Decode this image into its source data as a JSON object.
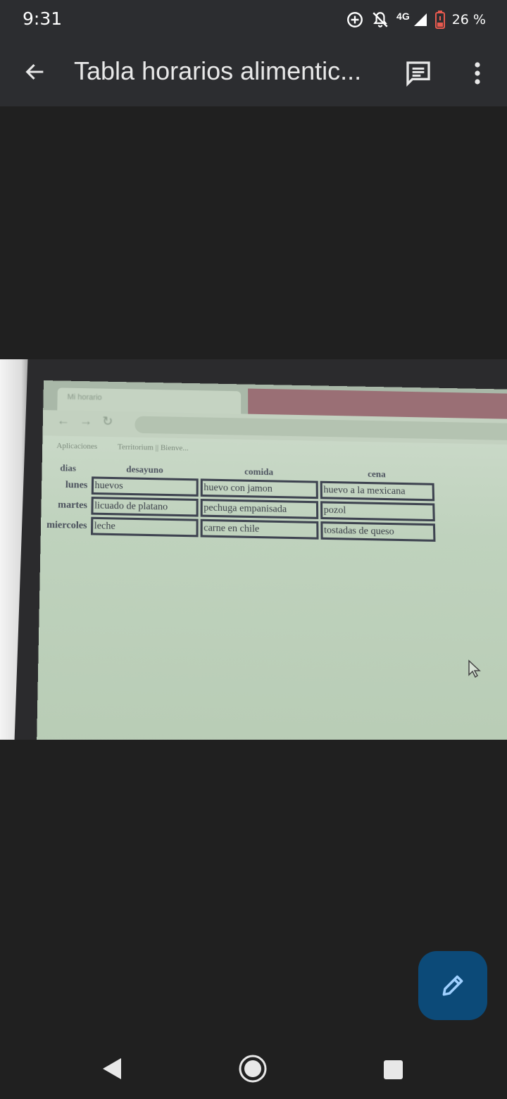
{
  "status": {
    "time": "9:31",
    "network": "4G",
    "battery": "26 %",
    "icons": [
      "data-saver-icon",
      "notifications-off-icon",
      "signal-icon",
      "battery-low-icon"
    ]
  },
  "appbar": {
    "title": "Tabla horarios alimentic...",
    "back_icon": "arrow-back-icon",
    "comment_icon": "comment-icon",
    "more_icon": "more-vert-icon"
  },
  "photo": {
    "browser_tab": "Mi horario",
    "bookmarks": [
      "Aplicaciones",
      "Territorium || Bienve..."
    ],
    "table": {
      "headers": [
        "dias",
        "desayuno",
        "comida",
        "cena"
      ],
      "rows": [
        {
          "day": "lunes",
          "desayuno": "huevos",
          "comida": "huevo con jamon",
          "cena": "huevo a la mexicana"
        },
        {
          "day": "martes",
          "desayuno": "licuado de platano",
          "comida": "pechuga empanisada",
          "cena": "pozol"
        },
        {
          "day": "miercoles",
          "desayuno": "leche",
          "comida": "carne en chile",
          "cena": "tostadas de queso"
        }
      ]
    }
  },
  "fab": {
    "icon": "edit-pencil-icon"
  },
  "colors": {
    "fab": "#0c4a78",
    "appbar": "#2c2d30",
    "background": "#202020"
  }
}
